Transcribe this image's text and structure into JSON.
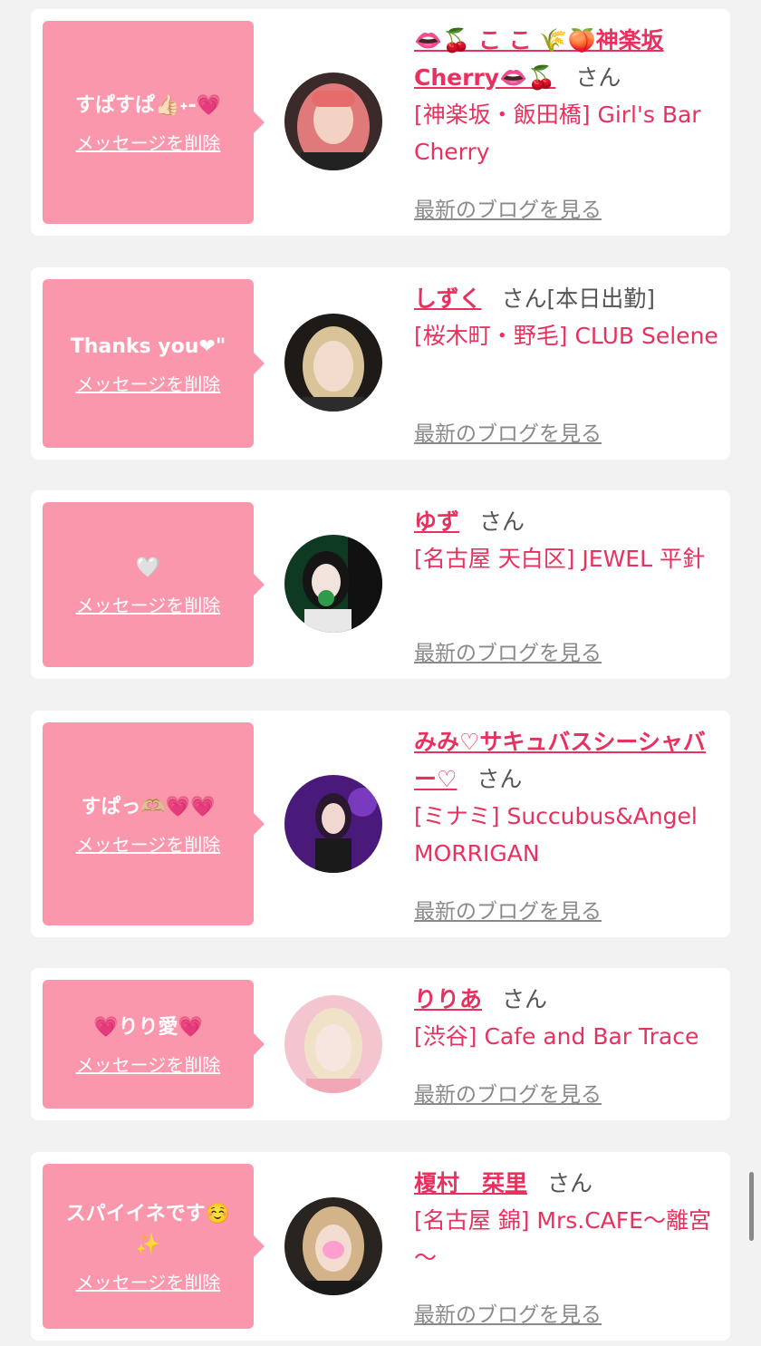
{
  "colors": {
    "page_bg": "#f2f2f2",
    "card_bg": "#ffffff",
    "bubble_bg": "#fb97ad",
    "accent": "#e8315f",
    "muted": "#8a8a8a"
  },
  "messages": [
    {
      "message": "すぱすぱ👍🏻˖-💗",
      "delete_label": "メッセージを削除",
      "name": "👄🍒 こ こ 🌾🍑神楽坂Cherry👄🍒",
      "honorific": "さん",
      "status": "",
      "shop": "[神楽坂・飯田橋] Girl's Bar Cherry",
      "blog_label": "最新のブログを見る",
      "avatar": "avatar-photo-pink-hair"
    },
    {
      "message": "Thanks you❤︎\"",
      "delete_label": "メッセージを削除",
      "name": "しずく",
      "honorific": "さん",
      "status": "[本日出勤]",
      "shop": "[桜木町・野毛] CLUB Selene",
      "blog_label": "最新のブログを見る",
      "avatar": "avatar-photo-blonde"
    },
    {
      "message": "🤍",
      "delete_label": "メッセージを削除",
      "name": "ゆず",
      "honorific": "さん",
      "status": "",
      "shop": "[名古屋 天白区] JEWEL 平針",
      "blog_label": "最新のブログを見る",
      "avatar": "avatar-photo-green-room"
    },
    {
      "message": "すぱっ🫶🏼💗💗",
      "delete_label": "メッセージを削除",
      "name": "みみ♡サキュバスシーシャバー♡",
      "honorific": "さん",
      "status": "",
      "shop": "[ミナミ] Succubus&Angel MORRIGAN",
      "blog_label": "最新のブログを見る",
      "avatar": "avatar-photo-purple"
    },
    {
      "message": "💗りり愛💗",
      "delete_label": "メッセージを削除",
      "name": "りりあ",
      "honorific": "さん",
      "status": "",
      "shop": "[渋谷] Cafe and Bar Trace",
      "blog_label": "最新のブログを見る",
      "avatar": "avatar-photo-pink-bg"
    },
    {
      "message": "スパイイネです☺️\n✨",
      "delete_label": "メッセージを削除",
      "name": "榎村　栞里",
      "honorific": "さん",
      "status": "",
      "shop": "[名古屋 錦] Mrs.CAFE～離宮～",
      "blog_label": "最新のブログを見る",
      "avatar": "avatar-photo-blurred"
    }
  ]
}
